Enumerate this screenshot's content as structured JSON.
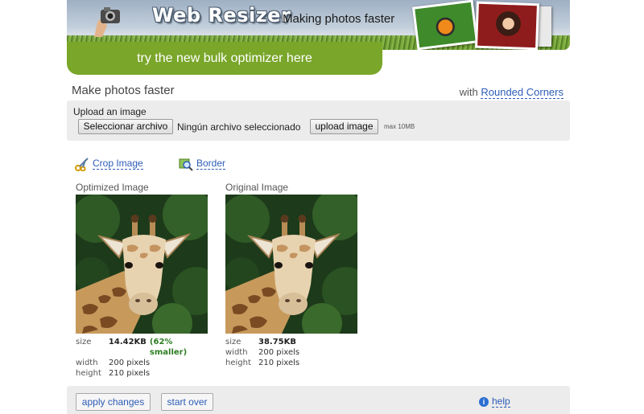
{
  "header": {
    "brand": "Web Resizer",
    "tagline": "Making photos faster",
    "promo": "try the new bulk optimizer here"
  },
  "page": {
    "title": "Make photos faster",
    "with_prefix": "with",
    "with_link": "Rounded Corners"
  },
  "upload": {
    "label": "Upload an image",
    "file_button": "Seleccionar archivo",
    "no_file": "Ningún archivo seleccionado",
    "upload_button": "upload image",
    "max_size": "max 10MB"
  },
  "tools": {
    "crop": "Crop Image",
    "border": "Border"
  },
  "optimized": {
    "title": "Optimized Image",
    "size_label": "size",
    "size": "14.42KB",
    "savings": "(62% smaller)",
    "width_label": "width",
    "width": "200 pixels",
    "height_label": "height",
    "height": "210 pixels"
  },
  "original": {
    "title": "Original Image",
    "size_label": "size",
    "size": "38.75KB",
    "width_label": "width",
    "width": "200 pixels",
    "height_label": "height",
    "height": "210 pixels"
  },
  "actions": {
    "apply": "apply changes",
    "start_over": "start over",
    "help": "help"
  },
  "colors": {
    "accent_green": "#7aa62a",
    "link_blue": "#2c5cb6",
    "savings_green": "#2d7d22",
    "panel_gray": "#ececec"
  },
  "icons": [
    "camera-hand-icon",
    "scissors-icon",
    "border-magnifier-icon",
    "info-icon"
  ]
}
